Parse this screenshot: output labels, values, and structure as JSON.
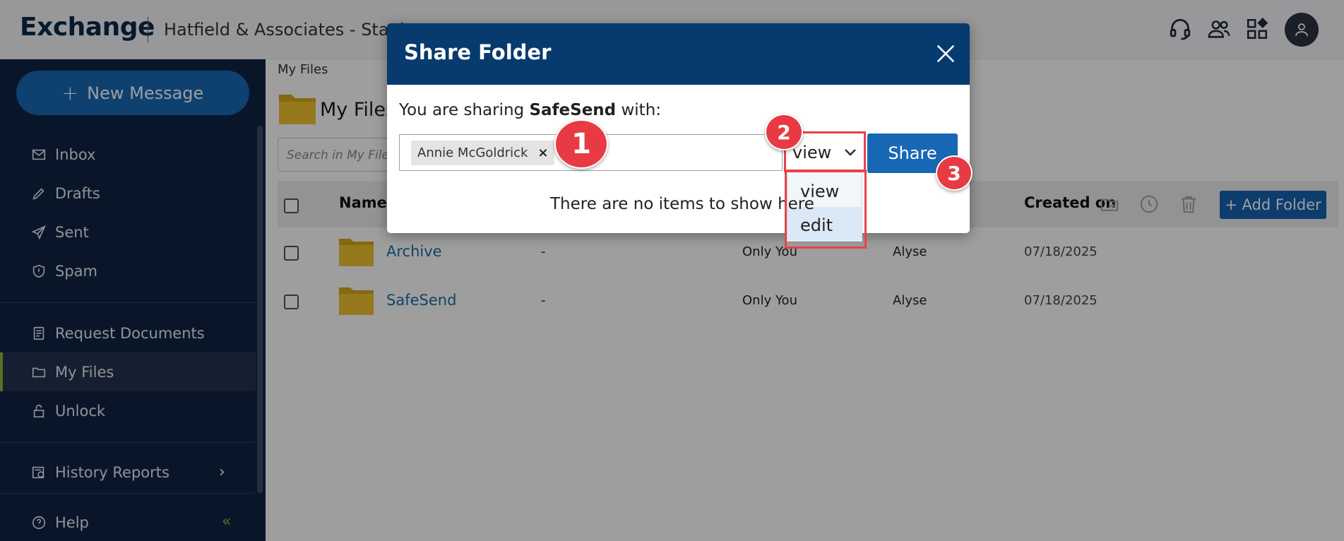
{
  "header": {
    "logo": "Exchange",
    "org_name": "Hatfield & Associates - Staging",
    "icons": [
      "headset-icon",
      "contacts-icon",
      "apps-icon",
      "user-avatar-icon"
    ]
  },
  "sidebar": {
    "new_message": "New Message",
    "items": [
      {
        "label": "Inbox",
        "icon": "inbox-icon"
      },
      {
        "label": "Drafts",
        "icon": "pencil-icon"
      },
      {
        "label": "Sent",
        "icon": "send-icon"
      },
      {
        "label": "Spam",
        "icon": "shield-icon"
      },
      {
        "label": "Request Documents",
        "icon": "document-icon"
      },
      {
        "label": "My Files",
        "icon": "folder-icon"
      },
      {
        "label": "Unlock",
        "icon": "unlock-icon"
      },
      {
        "label": "History Reports",
        "icon": "report-icon"
      },
      {
        "label": "Help",
        "icon": "help-icon"
      }
    ],
    "active_item": "My Files"
  },
  "main": {
    "breadcrumb": "My Files",
    "title": "My Files",
    "search_placeholder": "Search in My Files",
    "columns": {
      "name": "Name",
      "created_on": "Created on"
    },
    "add_folder": "+ Add Folder",
    "rows": [
      {
        "name": "Archive",
        "size": "-",
        "shared": "Only You",
        "owner": "Alyse",
        "created": "07/18/2025"
      },
      {
        "name": "SafeSend",
        "size": "-",
        "shared": "Only You",
        "owner": "Alyse",
        "created": "07/18/2025"
      }
    ]
  },
  "modal": {
    "title": "Share Folder",
    "sharing_prefix": "You are sharing",
    "folder_name": "SafeSend",
    "sharing_suffix": "with:",
    "recipient": "Annie McGoldrick",
    "recipient_remove": "×",
    "permission_value": "view",
    "permission_options": [
      "view",
      "edit"
    ],
    "highlighted_option": "edit",
    "share_button": "Share",
    "empty_message": "There are no items to show here"
  },
  "annotations": [
    "1",
    "2",
    "3"
  ],
  "colors": {
    "brand_navy": "#073a6e",
    "sidebar_bg": "#0f2545",
    "accent_blue": "#1868b5",
    "callout_red": "#e83a43",
    "active_green": "#8ab83a"
  }
}
